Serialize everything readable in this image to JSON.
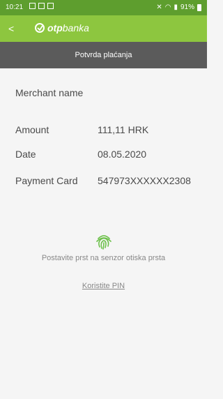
{
  "status_bar": {
    "time": "10:21",
    "battery": "91%",
    "icons": [
      "gallery-icon",
      "download-icon",
      "message-icon",
      "mute-icon",
      "wifi-icon",
      "signal-icon",
      "battery-icon"
    ]
  },
  "app_bar": {
    "brand_prefix": "otp",
    "brand_suffix": "banka",
    "back_icon": "chevron-left-icon",
    "colors": {
      "app_bar": "#8dc63f",
      "status_bar": "#5e9e2e"
    }
  },
  "title_bar": {
    "title": "Potvrda plaćanja",
    "color": "#5b5b5b"
  },
  "details": {
    "merchant_label": "Merchant name",
    "merchant_value": "",
    "amount_label": "Amount",
    "amount_value": "111,11 HRK",
    "date_label": "Date",
    "date_value": "08.05.2020",
    "card_label": "Payment Card",
    "card_value": "547973XXXXXX2308"
  },
  "fingerprint": {
    "icon": "fingerprint-icon",
    "hint": "Postavite prst na senzor otiska prsta",
    "color": "#6cc04a"
  },
  "pin_link": "Koristite PIN"
}
